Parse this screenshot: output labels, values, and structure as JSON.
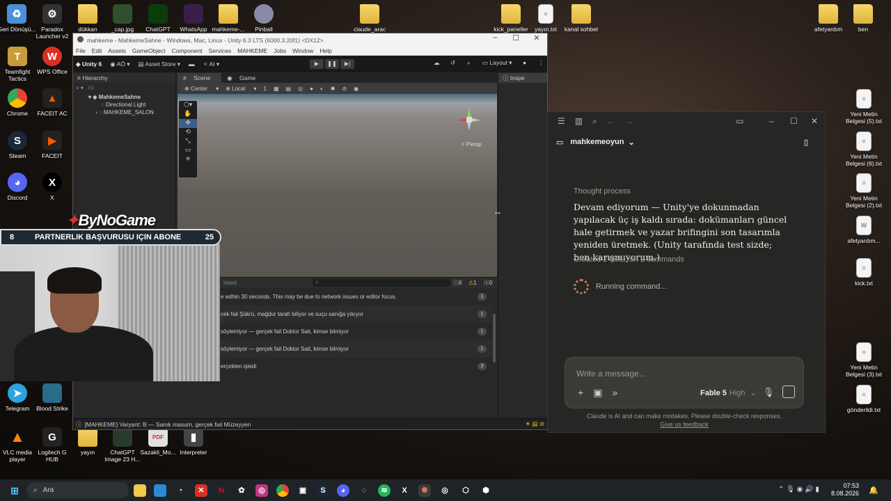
{
  "desktop": {
    "icons_left": [
      {
        "label": "Geri Dönüşü...",
        "icon": "recycle-bin-icon",
        "color": "#4a90d9"
      },
      {
        "label": "Paradox Launcher v2",
        "icon": "paradox-icon",
        "color": "#333333"
      },
      {
        "label": "dükkan",
        "icon": "folder-icon",
        "color": "#f2c94c"
      },
      {
        "label": "_cap.jpg",
        "icon": "image-icon",
        "color": "#2f4f2f"
      },
      {
        "label": "ChatGPT",
        "icon": "chatgpt-icon",
        "color": "#0a3d0a"
      },
      {
        "label": "WhatsApp",
        "icon": "whatsapp-icon",
        "color": "#3a1e4a"
      },
      {
        "label": "mahkeme-...",
        "icon": "folder-icon",
        "color": "#f2c94c"
      },
      {
        "label": "Pinball",
        "icon": "pinball-icon",
        "color": "#8a8aa8"
      },
      {
        "label": "claude_arac",
        "icon": "folder-icon",
        "color": "#f2c94c"
      },
      {
        "label": "kick_paneller",
        "icon": "folder-icon",
        "color": "#f2c94c"
      },
      {
        "label": "yayın.txt",
        "icon": "text-file-icon",
        "color": "#f4f4f4"
      },
      {
        "label": "kanal sohbet",
        "icon": "folder-icon",
        "color": "#f2c94c"
      },
      {
        "label": "afetyardım",
        "icon": "folder-icon",
        "color": "#f2c94c"
      },
      {
        "label": "ben",
        "icon": "folder-icon",
        "color": "#f2c94c"
      }
    ],
    "column1": [
      {
        "label": "Teamfight Tactics",
        "icon": "tft-icon",
        "color": "#c89b3c"
      },
      {
        "label": "Chrome",
        "icon": "chrome-icon",
        "color": "#4285f4"
      },
      {
        "label": "Steam",
        "icon": "steam-icon",
        "color": "#1b2838"
      },
      {
        "label": "Discord",
        "icon": "discord-icon",
        "color": "#5865f2"
      }
    ],
    "column2": [
      {
        "label": "WPS Office",
        "icon": "wps-icon",
        "color": "#d93025"
      },
      {
        "label": "FACEIT AC",
        "icon": "faceit-ac-icon",
        "color": "#ff5500"
      },
      {
        "label": "FACEIT",
        "icon": "faceit-icon",
        "color": "#222222"
      },
      {
        "label": "X",
        "icon": "x-icon",
        "color": "#000000"
      }
    ],
    "bottom": [
      {
        "label": "Telegram",
        "icon": "telegram-icon",
        "color": "#2aa3df"
      },
      {
        "label": "Blood Strike",
        "icon": "blood-strike-icon",
        "color": "#2a6a8a"
      },
      {
        "label": "VLC media player",
        "icon": "vlc-icon",
        "color": "#ff8800"
      },
      {
        "label": "Logitech G HUB",
        "icon": "logitech-icon",
        "color": "#222222"
      },
      {
        "label": "yayın",
        "icon": "folder-icon",
        "color": "#f2c94c"
      },
      {
        "label": "ChatGPT Image 23 H...",
        "icon": "image-icon",
        "color": "#2a3a2a"
      },
      {
        "label": "Sazakli_Mo...",
        "icon": "pdf-icon",
        "color": "#e0e0e0"
      },
      {
        "label": "Interpreter",
        "icon": "interpreter-icon",
        "color": "#444444"
      }
    ],
    "right": [
      {
        "label": "Yeni Metin Belgesi (5).txt",
        "icon": "text-file-icon"
      },
      {
        "label": "Yeni Metin Belgesi (6).txt",
        "icon": "text-file-icon"
      },
      {
        "label": "Yeni Metin Belgesi (2).txt",
        "icon": "text-file-icon"
      },
      {
        "label": "afetyardım...",
        "icon": "word-file-icon"
      },
      {
        "label": "kick.txt",
        "icon": "text-file-icon"
      },
      {
        "label": "Yeni Metin Belgesi (3).txt",
        "icon": "text-file-icon"
      },
      {
        "label": "gönderildi.txt",
        "icon": "text-file-icon"
      }
    ]
  },
  "unity": {
    "title": "mahkeme - MahkemeSahne - Windows, Mac, Linux - Unity 6.3 LTS (6000.3.20f1) <DX12>",
    "menu": [
      "File",
      "Edit",
      "Assets",
      "GameObject",
      "Component",
      "Services",
      "MAHKEME",
      "Jobs",
      "Window",
      "Help"
    ],
    "toolbar": {
      "version": "Unity 6",
      "account": "AÖ",
      "asset_store": "Asset Store",
      "ai": "AI",
      "layout": "Layout"
    },
    "hierarchy": {
      "tab": "Hierarchy",
      "search_placeholder": "All",
      "items": [
        "MahkemeSahne",
        "Directional Light",
        "MAHKEME_SALON"
      ]
    },
    "scene": {
      "tabs": [
        "Scene",
        "Game"
      ],
      "pivot": "Center",
      "space": "Local",
      "grid": "1",
      "persp": "< Persp"
    },
    "inspector": {
      "tab": "Inspe"
    },
    "console": {
      "search_hint": "istant",
      "counts": {
        "info": "6",
        "warn": "1",
        "error": "0"
      },
      "rows": [
        {
          "text": "e within 30 seconds. This may be due to network issues or editor focus.",
          "count": "1"
        },
        {
          "text": "cek fail Şükrü, mağdur tarafı biliyor ve suçu sanığa yıkıyor",
          "count": "1"
        },
        {
          "text": "söylemiyor — gerçek fail Doktor Sait, kimse bilmiyor",
          "count": "1"
        },
        {
          "text": "söylemiyor — gerçek fail Doktor Sait, kimse bilmiyor",
          "count": "1"
        },
        {
          "text": "erçekten işledi",
          "count": "3"
        }
      ]
    },
    "status": "[MAHKEME] Varyant: B — Sanık masum, gerçek fail Müzeyyen"
  },
  "overlay": {
    "brand": "ByNoGame",
    "banner_left": "8",
    "banner_text": "PARTNERLIK BAŞVURUSU IÇIN ABONE",
    "banner_right": "25"
  },
  "claude": {
    "project": "mahkemeoyun",
    "thought_label": "Thought process",
    "thought_text": "Devam ediyorum — Unity'ye dokunmadan yapılacak üç iş kaldı sırada: dokümanları güncel hale getirmek ve yazar brifingini son tasarımla yeniden üretmek. (Unity tarafında test sizde; ben karışmıyorum.)",
    "created": "Created 2 files, ran 2 commands",
    "running": "Running command...",
    "composer_placeholder": "Write a message...",
    "model": "Fable 5",
    "effort": "High",
    "disclaimer": "Claude is AI and can make mistakes. Please double-check responses.",
    "feedback": "Give us feedback",
    "accent": "#d97757"
  },
  "taskbar": {
    "search": "Ara",
    "time": "07:53",
    "date": "8.08.2026"
  }
}
